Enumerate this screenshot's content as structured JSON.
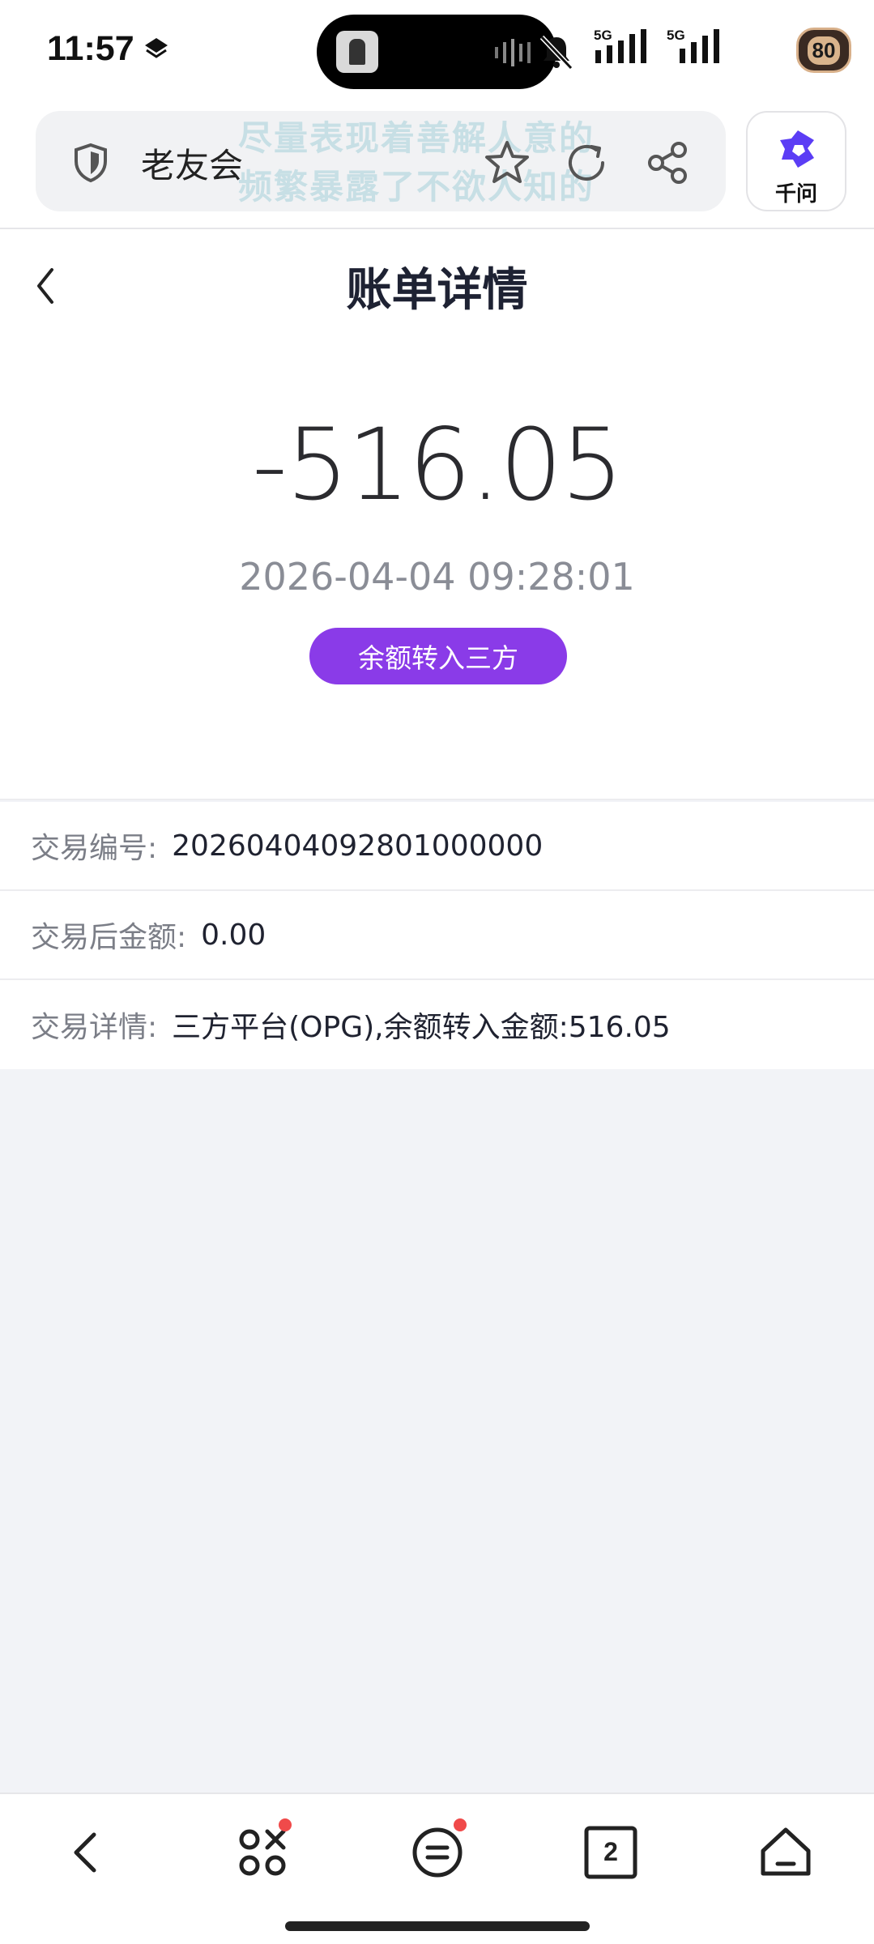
{
  "status_bar": {
    "time": "11:57",
    "network_1": "5G",
    "network_2": "5G",
    "battery": "80"
  },
  "browser": {
    "site_name": "老友会",
    "watermark_line1": "尽量表现着善解人意的",
    "watermark_line2": "频繁暴露了不欲人知的",
    "ai_label": "千问",
    "accent_color": "#5b3df5"
  },
  "header": {
    "title": "账单详情"
  },
  "summary": {
    "amount": "-516.05",
    "datetime": "2026-04-04 09:28:01",
    "type_badge": "余额转入三方",
    "badge_color": "#8a3be8"
  },
  "details": [
    {
      "label": "交易编号:",
      "value": "20260404092801000000"
    },
    {
      "label": "交易后金额:",
      "value": "0.00"
    },
    {
      "label": "交易详情:",
      "value": "三方平台(OPG),余额转入金额:516.05"
    }
  ],
  "bottom_nav": {
    "tab_count": "2",
    "items": [
      "back-icon",
      "apps-icon",
      "menu-icon",
      "tabs-icon",
      "home-icon"
    ]
  }
}
